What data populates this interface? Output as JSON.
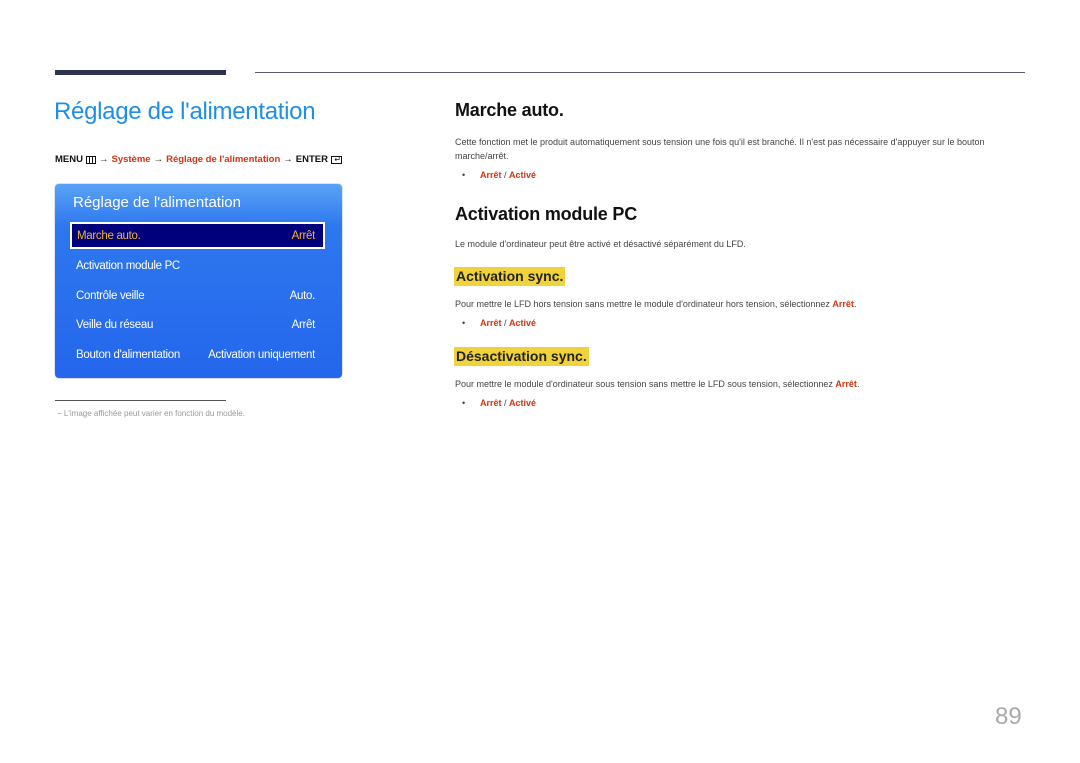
{
  "page": {
    "title": "Réglage de l'alimentation",
    "page_number": "89"
  },
  "menu_path": {
    "menu": "MENU",
    "arrow": "→",
    "system": "Système",
    "power": "Réglage de l'alimentation",
    "enter": "ENTER"
  },
  "osd": {
    "title": "Réglage de l'alimentation",
    "items": [
      {
        "label": "Marche auto.",
        "value": "Arrêt",
        "selected": true
      },
      {
        "label": "Activation module PC",
        "value": ""
      },
      {
        "label": "Contrôle veille",
        "value": "Auto."
      },
      {
        "label": "Veille du réseau",
        "value": "Arrêt"
      },
      {
        "label": "Bouton d'alimentation",
        "value": "Activation uniquement"
      }
    ]
  },
  "footnote": "L'image affichée peut varier en fonction du modèle.",
  "footnote_dash": "−",
  "sections": {
    "marche_auto": {
      "heading": "Marche auto.",
      "text": "Cette fonction met le produit automatiquement sous tension une fois qu'il est branché. Il n'est pas nécessaire d'appuyer sur le bouton marche/arrêt.",
      "options": {
        "off": "Arrêt",
        "sep": " / ",
        "on": "Activé"
      }
    },
    "module_pc": {
      "heading": "Activation module PC",
      "text": "Le module d'ordinateur peut être activé et désactivé séparément du LFD."
    },
    "activation_sync": {
      "heading": "Activation sync.",
      "text_before": "Pour mettre le LFD hors tension sans mettre le module d'ordinateur hors tension, sélectionnez ",
      "text_highlight": "Arrêt",
      "text_after": ".",
      "options": {
        "off": "Arrêt",
        "sep": " / ",
        "on": "Activé"
      }
    },
    "desactivation_sync": {
      "heading": "Désactivation sync.",
      "text_before": "Pour mettre le module d'ordinateur sous tension sans mettre le LFD sous tension, sélectionnez ",
      "text_highlight": "Arrêt",
      "text_after": ".",
      "options": {
        "off": "Arrêt",
        "sep": " / ",
        "on": "Activé"
      }
    }
  },
  "bullet_glyph": "•",
  "colors": {
    "title_blue": "#1e8fe6",
    "accent_red": "#d0360f",
    "highlight_yellow": "#f0d33a",
    "osd_blue": "#2466ec",
    "osd_selected_bg": "#00007d",
    "osd_selected_text": "#f0b534"
  }
}
